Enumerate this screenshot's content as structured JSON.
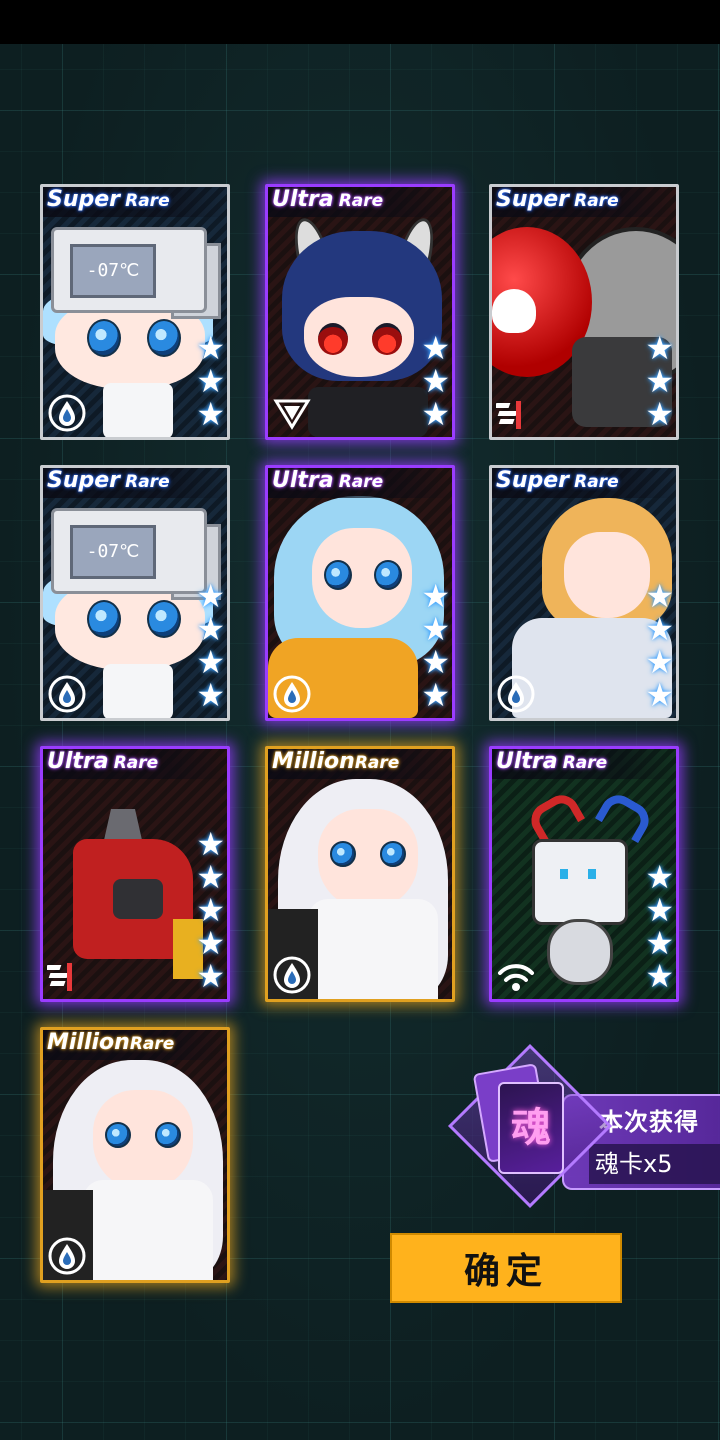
{
  "cards": [
    {
      "rarity_big": "Super",
      "rarity_small": "Rare",
      "stars": [
        "★",
        "★",
        "★"
      ],
      "element": "water-drop-icon",
      "readout": "-07℃"
    },
    {
      "rarity_big": "Ultra",
      "rarity_small": "Rare",
      "stars": [
        "★",
        "★",
        "★"
      ],
      "element": "triangle-emblem-icon"
    },
    {
      "rarity_big": "Super",
      "rarity_small": "Rare",
      "stars": [
        "★",
        "★",
        "★"
      ],
      "element": "stripes-emblem-icon"
    },
    {
      "rarity_big": "Super",
      "rarity_small": "Rare",
      "stars": [
        "★",
        "★",
        "★",
        "★"
      ],
      "element": "water-drop-icon",
      "readout": "-07℃"
    },
    {
      "rarity_big": "Ultra",
      "rarity_small": "Rare",
      "stars": [
        "★",
        "★",
        "★",
        "★"
      ],
      "element": "water-drop-icon"
    },
    {
      "rarity_big": "Super",
      "rarity_small": "Rare",
      "stars": [
        "★",
        "★",
        "★",
        "★"
      ],
      "element": "water-drop-icon"
    },
    {
      "rarity_big": "Ultra",
      "rarity_small": "Rare",
      "stars": [
        "★",
        "★",
        "★",
        "★",
        "★"
      ],
      "element": "stripes-emblem-icon"
    },
    {
      "rarity_big": "Million",
      "rarity_small": "Rare",
      "stars": [],
      "element": "water-drop-icon"
    },
    {
      "rarity_big": "Ultra",
      "rarity_small": "Rare",
      "stars": [
        "★",
        "★",
        "★",
        "★"
      ],
      "element": "wifi-emblem-icon"
    },
    {
      "rarity_big": "Million",
      "rarity_small": "Rare",
      "stars": [],
      "element": "water-drop-icon"
    }
  ],
  "reward": {
    "card_glyph": "魂",
    "title": "本次获得",
    "count": "魂卡x5"
  },
  "confirm_label": "确定",
  "colors": {
    "ultra_rare_glow": "#9a3cff",
    "million_rare_glow": "#e0a020",
    "super_rare_border": "#c9ccd0",
    "confirm_button": "#ffb21c",
    "star_glow": "#3aa0ff"
  }
}
